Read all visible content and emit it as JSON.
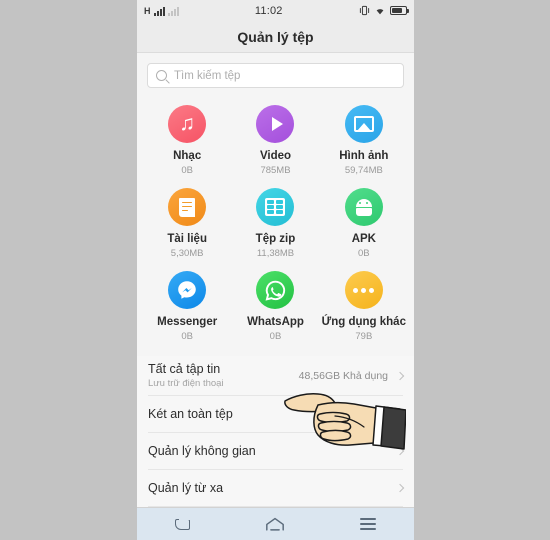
{
  "statusbar": {
    "time": "11:02",
    "signal_icon": "signal-bars-icon",
    "signal_secondary_icon": "signal-bars-dim-icon",
    "vibrate_icon": "vibrate-icon",
    "wifi_icon": "wifi-icon",
    "battery_icon": "battery-icon"
  },
  "header": {
    "title": "Quản lý tệp"
  },
  "search": {
    "placeholder": "Tìm kiếm tệp",
    "icon": "search-icon"
  },
  "categories": [
    {
      "name": "Nhạc",
      "size": "0B",
      "icon": "music-icon",
      "color": "#f9606d"
    },
    {
      "name": "Video",
      "size": "785MB",
      "icon": "video-play-icon",
      "color": "#b05ae0"
    },
    {
      "name": "Hình ảnh",
      "size": "59,74MB",
      "icon": "image-icon",
      "color": "#35aeef"
    },
    {
      "name": "Tài liệu",
      "size": "5,30MB",
      "icon": "document-icon",
      "color": "#f5982a"
    },
    {
      "name": "Tệp zip",
      "size": "11,38MB",
      "icon": "zip-icon",
      "color": "#2fc9dd"
    },
    {
      "name": "APK",
      "size": "0B",
      "icon": "android-icon",
      "color": "#3ad07a"
    },
    {
      "name": "Messenger",
      "size": "0B",
      "icon": "messenger-icon",
      "color": "#1e9bf0"
    },
    {
      "name": "WhatsApp",
      "size": "0B",
      "icon": "whatsapp-icon",
      "color": "#2fc84a"
    },
    {
      "name": "Ứng dụng khác",
      "size": "79B",
      "icon": "more-apps-icon",
      "color": "#f9be33"
    }
  ],
  "list": [
    {
      "title": "Tất cả tập tin",
      "subtitle": "Lưu trữ điện thoại",
      "value": "48,56GB  Khả dụng"
    },
    {
      "title": "Két an toàn tệp",
      "subtitle": "",
      "value": ""
    },
    {
      "title": "Quản lý không gian",
      "subtitle": "",
      "value": ""
    },
    {
      "title": "Quản lý từ xa",
      "subtitle": "",
      "value": ""
    }
  ],
  "navbar": {
    "back_icon": "back-icon",
    "home_icon": "home-icon",
    "menu_icon": "menu-icon"
  },
  "cursor": {
    "icon": "pointing-hand-cursor"
  },
  "colors": {
    "page_background": "#c3c3c3",
    "phone_background": "#f5f5f5",
    "navbar_background": "#dbe6f0"
  }
}
